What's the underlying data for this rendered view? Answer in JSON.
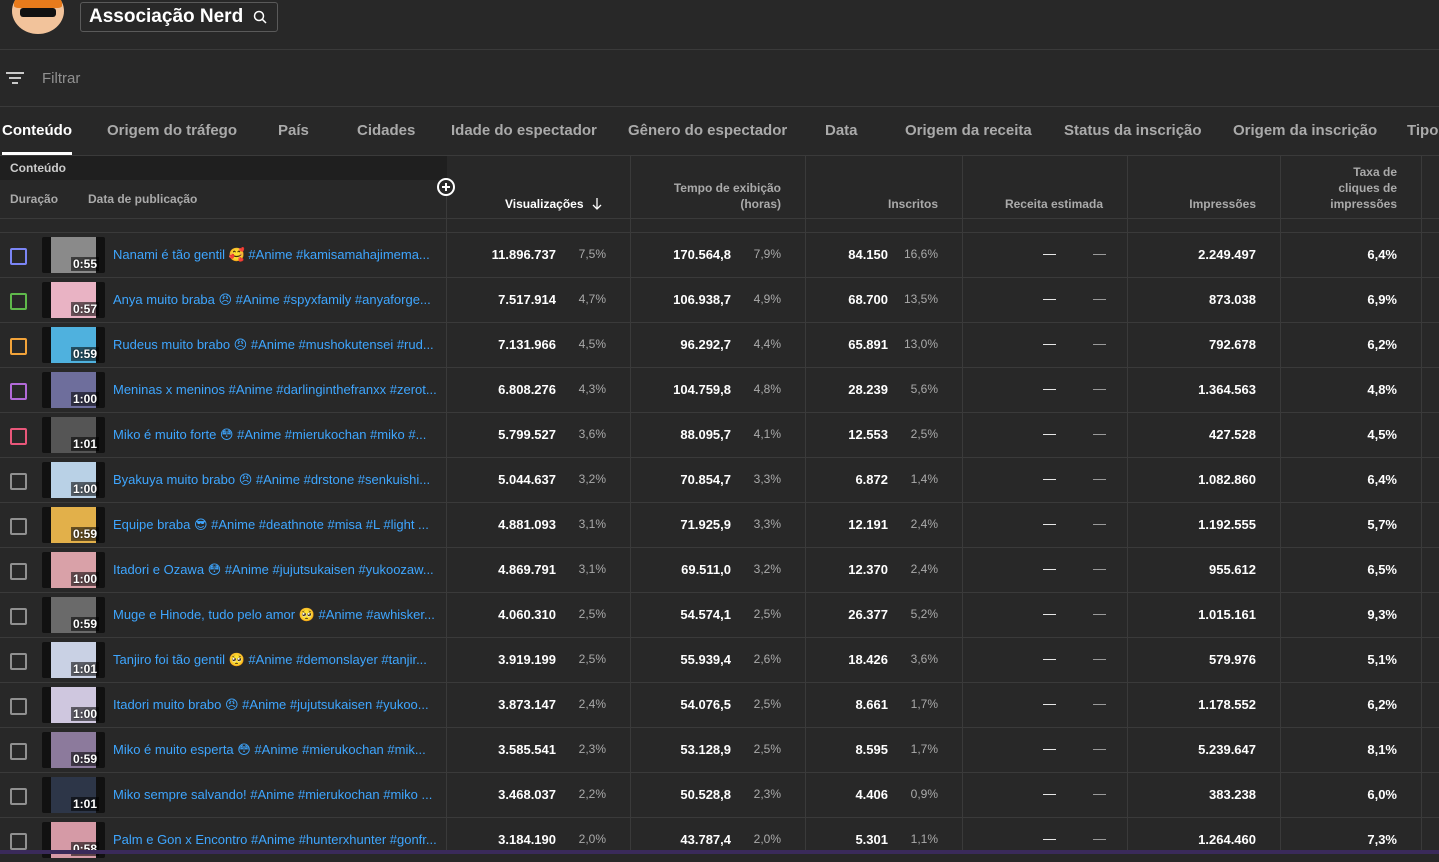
{
  "channel": {
    "name": "Associação Nerd"
  },
  "filter": {
    "placeholder": "Filtrar"
  },
  "tabs": [
    "Conteúdo",
    "Origem do tráfego",
    "País",
    "Cidades",
    "Idade do espectador",
    "Gênero do espectador",
    "Data",
    "Origem da receita",
    "Status da inscrição",
    "Origem da inscrição",
    "Tipo"
  ],
  "table": {
    "group_label": "Conteúdo",
    "col_duration": "Duração",
    "col_published": "Data de publicação",
    "col_views": "Visualizações",
    "col_watch_line1": "Tempo de exibição",
    "col_watch_line2": "(horas)",
    "col_subs": "Inscritos",
    "col_revenue": "Receita estimada",
    "col_impr": "Impressões",
    "col_ctr_line1": "Taxa de",
    "col_ctr_line2": "cliques de",
    "col_ctr_line3": "impressões"
  },
  "colors": {
    "accent_link": "#3ea6ff",
    "checkbox_1": "#7b85f5",
    "checkbox_2": "#5fb94b",
    "checkbox_3": "#f2a33a",
    "checkbox_4": "#b26ad8",
    "checkbox_5": "#e8577a"
  },
  "rows": [
    {
      "dur": "0:55",
      "title": "Nanami é tão gentil 🥰 #Anime #kamisamahajimema...",
      "views": "11.896.737",
      "views_pct": "7,5%",
      "watch": "170.564,8",
      "watch_pct": "7,9%",
      "subs": "84.150",
      "subs_pct": "16,6%",
      "rev": "—",
      "rev2": "—",
      "impr": "2.249.497",
      "ctr": "6,4%"
    },
    {
      "dur": "0:57",
      "title": "Anya muito braba 😠 #Anime #spyxfamily #anyaforge...",
      "views": "7.517.914",
      "views_pct": "4,7%",
      "watch": "106.938,7",
      "watch_pct": "4,9%",
      "subs": "68.700",
      "subs_pct": "13,5%",
      "rev": "—",
      "rev2": "—",
      "impr": "873.038",
      "ctr": "6,9%"
    },
    {
      "dur": "0:59",
      "title": "Rudeus muito brabo 😠 #Anime #mushokutensei #rud...",
      "views": "7.131.966",
      "views_pct": "4,5%",
      "watch": "96.292,7",
      "watch_pct": "4,4%",
      "subs": "65.891",
      "subs_pct": "13,0%",
      "rev": "—",
      "rev2": "—",
      "impr": "792.678",
      "ctr": "6,2%"
    },
    {
      "dur": "1:00",
      "title": "Meninas x meninos #Anime #darlinginthefranxx #zerot...",
      "views": "6.808.276",
      "views_pct": "4,3%",
      "watch": "104.759,8",
      "watch_pct": "4,8%",
      "subs": "28.239",
      "subs_pct": "5,6%",
      "rev": "—",
      "rev2": "—",
      "impr": "1.364.563",
      "ctr": "4,8%"
    },
    {
      "dur": "1:01",
      "title": "Miko é muito forte 😳 #Anime #mierukochan #miko #...",
      "views": "5.799.527",
      "views_pct": "3,6%",
      "watch": "88.095,7",
      "watch_pct": "4,1%",
      "subs": "12.553",
      "subs_pct": "2,5%",
      "rev": "—",
      "rev2": "—",
      "impr": "427.528",
      "ctr": "4,5%"
    },
    {
      "dur": "1:00",
      "title": "Byakuya muito brabo 😠 #Anime #drstone #senkuishi...",
      "views": "5.044.637",
      "views_pct": "3,2%",
      "watch": "70.854,7",
      "watch_pct": "3,3%",
      "subs": "6.872",
      "subs_pct": "1,4%",
      "rev": "—",
      "rev2": "—",
      "impr": "1.082.860",
      "ctr": "6,4%"
    },
    {
      "dur": "0:59",
      "title": "Equipe braba 😎 #Anime #deathnote #misa #L #light ...",
      "views": "4.881.093",
      "views_pct": "3,1%",
      "watch": "71.925,9",
      "watch_pct": "3,3%",
      "subs": "12.191",
      "subs_pct": "2,4%",
      "rev": "—",
      "rev2": "—",
      "impr": "1.192.555",
      "ctr": "5,7%"
    },
    {
      "dur": "1:00",
      "title": "Itadori e Ozawa 😳 #Anime #jujutsukaisen #yukoozaw...",
      "views": "4.869.791",
      "views_pct": "3,1%",
      "watch": "69.511,0",
      "watch_pct": "3,2%",
      "subs": "12.370",
      "subs_pct": "2,4%",
      "rev": "—",
      "rev2": "—",
      "impr": "955.612",
      "ctr": "6,5%"
    },
    {
      "dur": "0:59",
      "title": "Muge e Hinode, tudo pelo amor 🥺 #Anime #awhisker...",
      "views": "4.060.310",
      "views_pct": "2,5%",
      "watch": "54.574,1",
      "watch_pct": "2,5%",
      "subs": "26.377",
      "subs_pct": "5,2%",
      "rev": "—",
      "rev2": "—",
      "impr": "1.015.161",
      "ctr": "9,3%"
    },
    {
      "dur": "1:01",
      "title": "Tanjiro foi tão gentil 🥺 #Anime #demonslayer #tanjir...",
      "views": "3.919.199",
      "views_pct": "2,5%",
      "watch": "55.939,4",
      "watch_pct": "2,6%",
      "subs": "18.426",
      "subs_pct": "3,6%",
      "rev": "—",
      "rev2": "—",
      "impr": "579.976",
      "ctr": "5,1%"
    },
    {
      "dur": "1:00",
      "title": "Itadori muito brabo 😠 #Anime #jujutsukaisen #yukoo...",
      "views": "3.873.147",
      "views_pct": "2,4%",
      "watch": "54.076,5",
      "watch_pct": "2,5%",
      "subs": "8.661",
      "subs_pct": "1,7%",
      "rev": "—",
      "rev2": "—",
      "impr": "1.178.552",
      "ctr": "6,2%"
    },
    {
      "dur": "0:59",
      "title": "Miko é muito esperta 😳 #Anime #mierukochan #mik...",
      "views": "3.585.541",
      "views_pct": "2,3%",
      "watch": "53.128,9",
      "watch_pct": "2,5%",
      "subs": "8.595",
      "subs_pct": "1,7%",
      "rev": "—",
      "rev2": "—",
      "impr": "5.239.647",
      "ctr": "8,1%"
    },
    {
      "dur": "1:01",
      "title": "Miko sempre salvando! #Anime #mierukochan #miko ...",
      "views": "3.468.037",
      "views_pct": "2,2%",
      "watch": "50.528,8",
      "watch_pct": "2,3%",
      "subs": "4.406",
      "subs_pct": "0,9%",
      "rev": "—",
      "rev2": "—",
      "impr": "383.238",
      "ctr": "6,0%"
    },
    {
      "dur": "0:58",
      "title": "Palm e Gon x Encontro #Anime #hunterxhunter #gonfr...",
      "views": "3.184.190",
      "views_pct": "2,0%",
      "watch": "43.787,4",
      "watch_pct": "2,0%",
      "subs": "5.301",
      "subs_pct": "1,1%",
      "rev": "—",
      "rev2": "—",
      "impr": "1.264.460",
      "ctr": "7,3%"
    }
  ]
}
